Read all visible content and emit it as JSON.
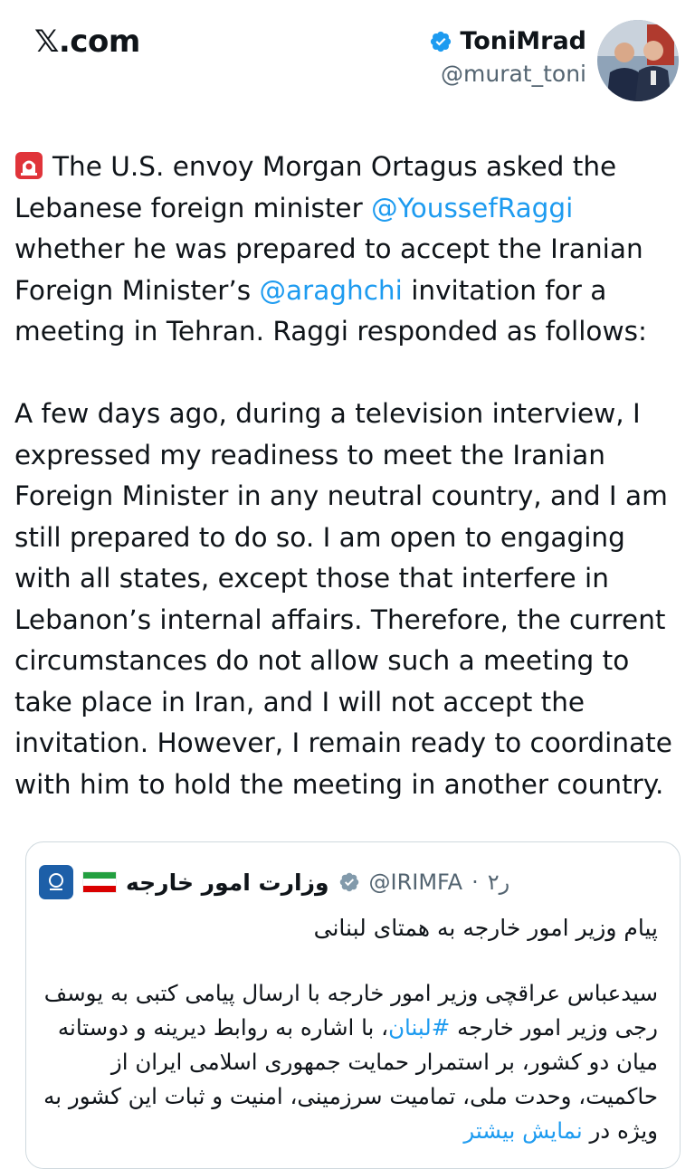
{
  "header": {
    "brand": "𝕏.com",
    "display_name": "ToniMrad",
    "handle": "@murat_toni"
  },
  "tweet": {
    "p1_a": "The U.S. envoy Morgan Ortagus asked the Lebanese foreign minister ",
    "p1_mention1": "@YoussefRaggi",
    "p1_b": " whether he was prepared to accept the Iranian Foreign Minister’s ",
    "p1_mention2": "@araghchi",
    "p1_c": " invitation for a meeting in Tehran. Raggi responded as follows:",
    "p2": " A few days ago, during a television interview, I expressed my readiness to meet the Iranian Foreign Minister in any neutral country, and I am still prepared to do so. I am open to engaging with all states, except those that interfere in Lebanon’s internal affairs. Therefore, the current circumstances do not allow such a meeting to take place in Iran, and I will not accept the invitation. However, I remain ready to coordinate with him to hold the meeting in another country."
  },
  "quote": {
    "name": "وزارت امور خارجه",
    "handle": "@IRIMFA",
    "time": "۲ر",
    "subtitle": "پیام وزیر امور خارجه به همتای لبنانی",
    "text_a": "سیدعباس عراقچی وزیر امور خارجه با ارسال پیامی کتبی به یوسف رجی وزیر امور خارجه ",
    "hashtag": "#لبنان",
    "text_b": "، با اشاره به روابط دیرینه و دوستانه میان دو کشور، بر استمرار حمایت جمهوری اسلامی ایران از حاکمیت، وحدت ملی، تمامیت سرزمینی، امنیت و ثبات این کشور به ویژه در ",
    "show_more": "نمایش بیشتر"
  },
  "colors": {
    "link": "#1d9bf0",
    "verified": "#1d9bf0",
    "text": "#0f1419",
    "muted": "#536471"
  }
}
